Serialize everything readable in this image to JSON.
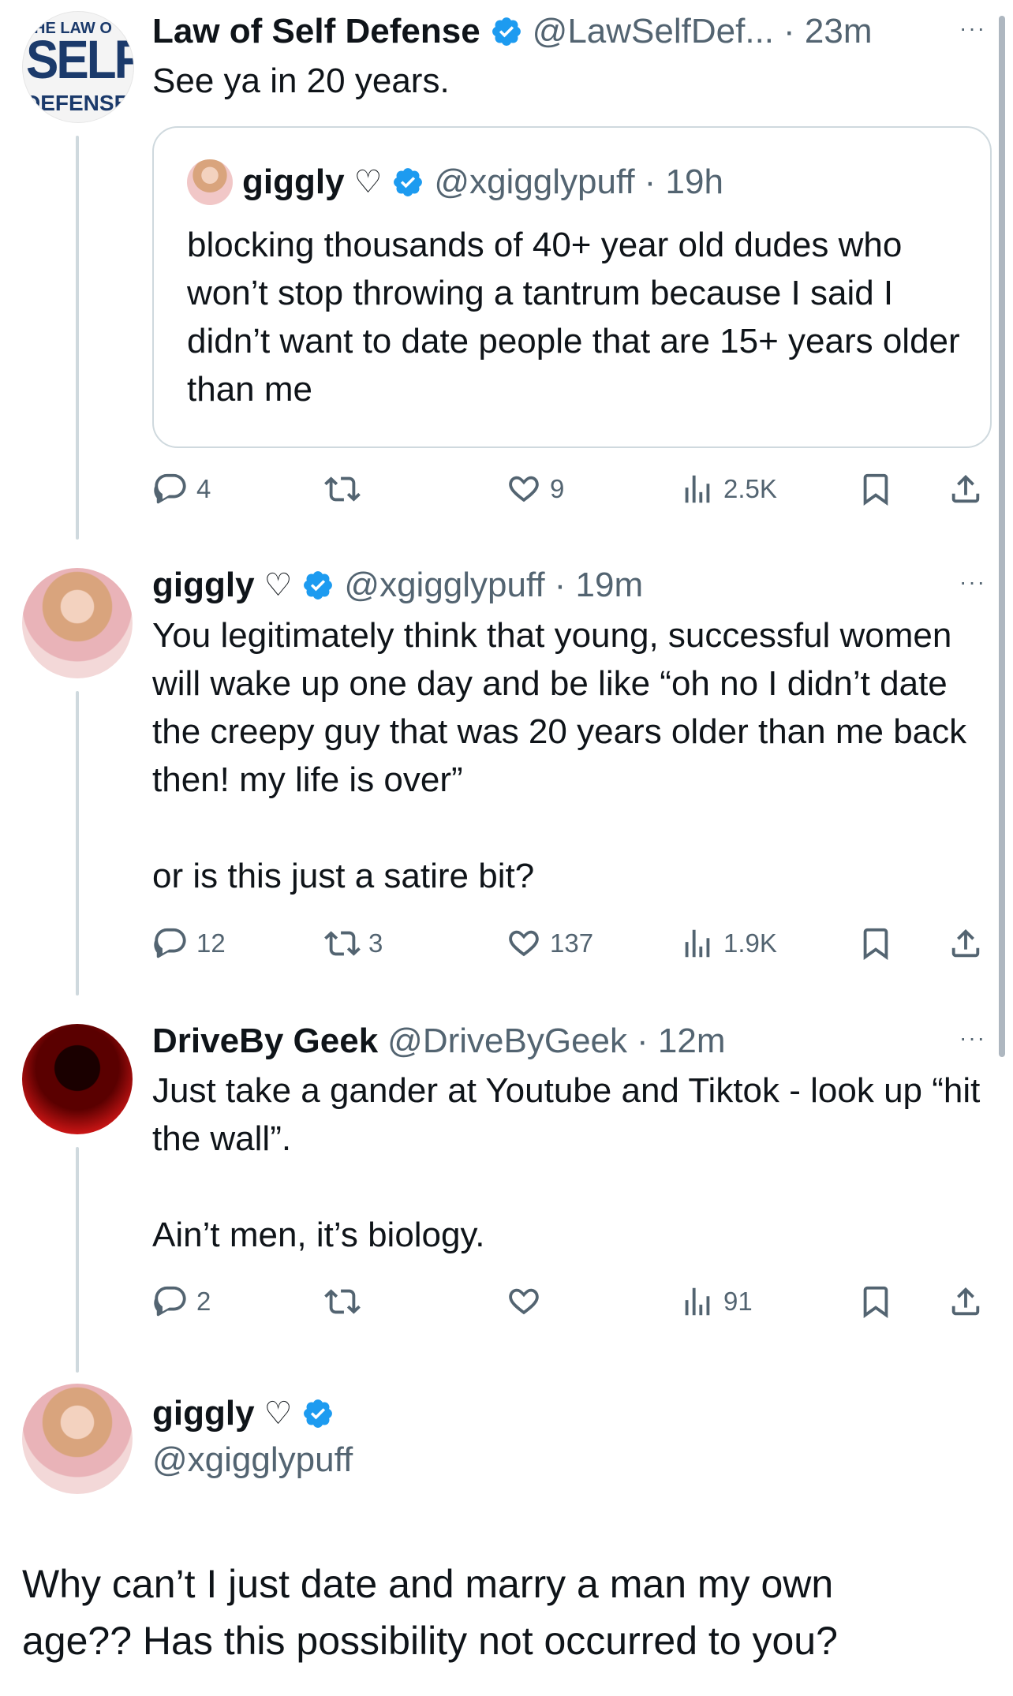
{
  "tweets": [
    {
      "name": "Law of Self Defense",
      "handle": "@LawSelfDef...",
      "time": "· 23m",
      "verified": true,
      "text": "See ya in 20 years.",
      "avatar_text": {
        "top": "HE LAW O",
        "mid": "SELF",
        "bot": "DEFENSE"
      },
      "quote": {
        "name": "giggly",
        "heart": "♡",
        "handle": "@xgigglypuff",
        "time": "· 19h",
        "text": "blocking thousands of 40+ year old dudes who won’t stop throwing a tantrum because I said I didn’t want to date people that are 15+ years older than me"
      },
      "actions": {
        "replies": "4",
        "retweets": "",
        "likes": "9",
        "views": "2.5K"
      }
    },
    {
      "name": "giggly",
      "heart": "♡",
      "handle": "@xgigglypuff",
      "time": "· 19m",
      "verified": true,
      "text": "You legitimately think that young, successful women will wake up one day and be like “oh no I didn’t date the creepy guy that was 20 years older than me back then! my life is over”\n\nor is this just a satire bit?",
      "actions": {
        "replies": "12",
        "retweets": "3",
        "likes": "137",
        "views": "1.9K"
      }
    },
    {
      "name": "DriveBy Geek",
      "handle": "@DriveByGeek",
      "time": "· 12m",
      "verified": false,
      "text": "Just take a gander at Youtube and Tiktok - look up “hit the wall”.\n\nAin’t men, it’s biology.",
      "actions": {
        "replies": "2",
        "retweets": "",
        "likes": "",
        "views": "91"
      }
    }
  ],
  "main_tweet": {
    "name": "giggly",
    "heart": "♡",
    "handle": "@xgigglypuff",
    "verified": true,
    "text": "Why can’t I just date and marry a man my own age?? Has this possibility not occurred to you?"
  },
  "icons": {
    "more": "···",
    "verified": "verified-badge-icon",
    "reply": "reply-icon",
    "retweet": "retweet-icon",
    "like": "heart-icon",
    "views": "views-icon",
    "bookmark": "bookmark-icon",
    "share": "share-icon"
  },
  "colors": {
    "text": "#0f1419",
    "secondary": "#536471",
    "verified": "#1d9bf0",
    "line": "#cfd9de"
  }
}
